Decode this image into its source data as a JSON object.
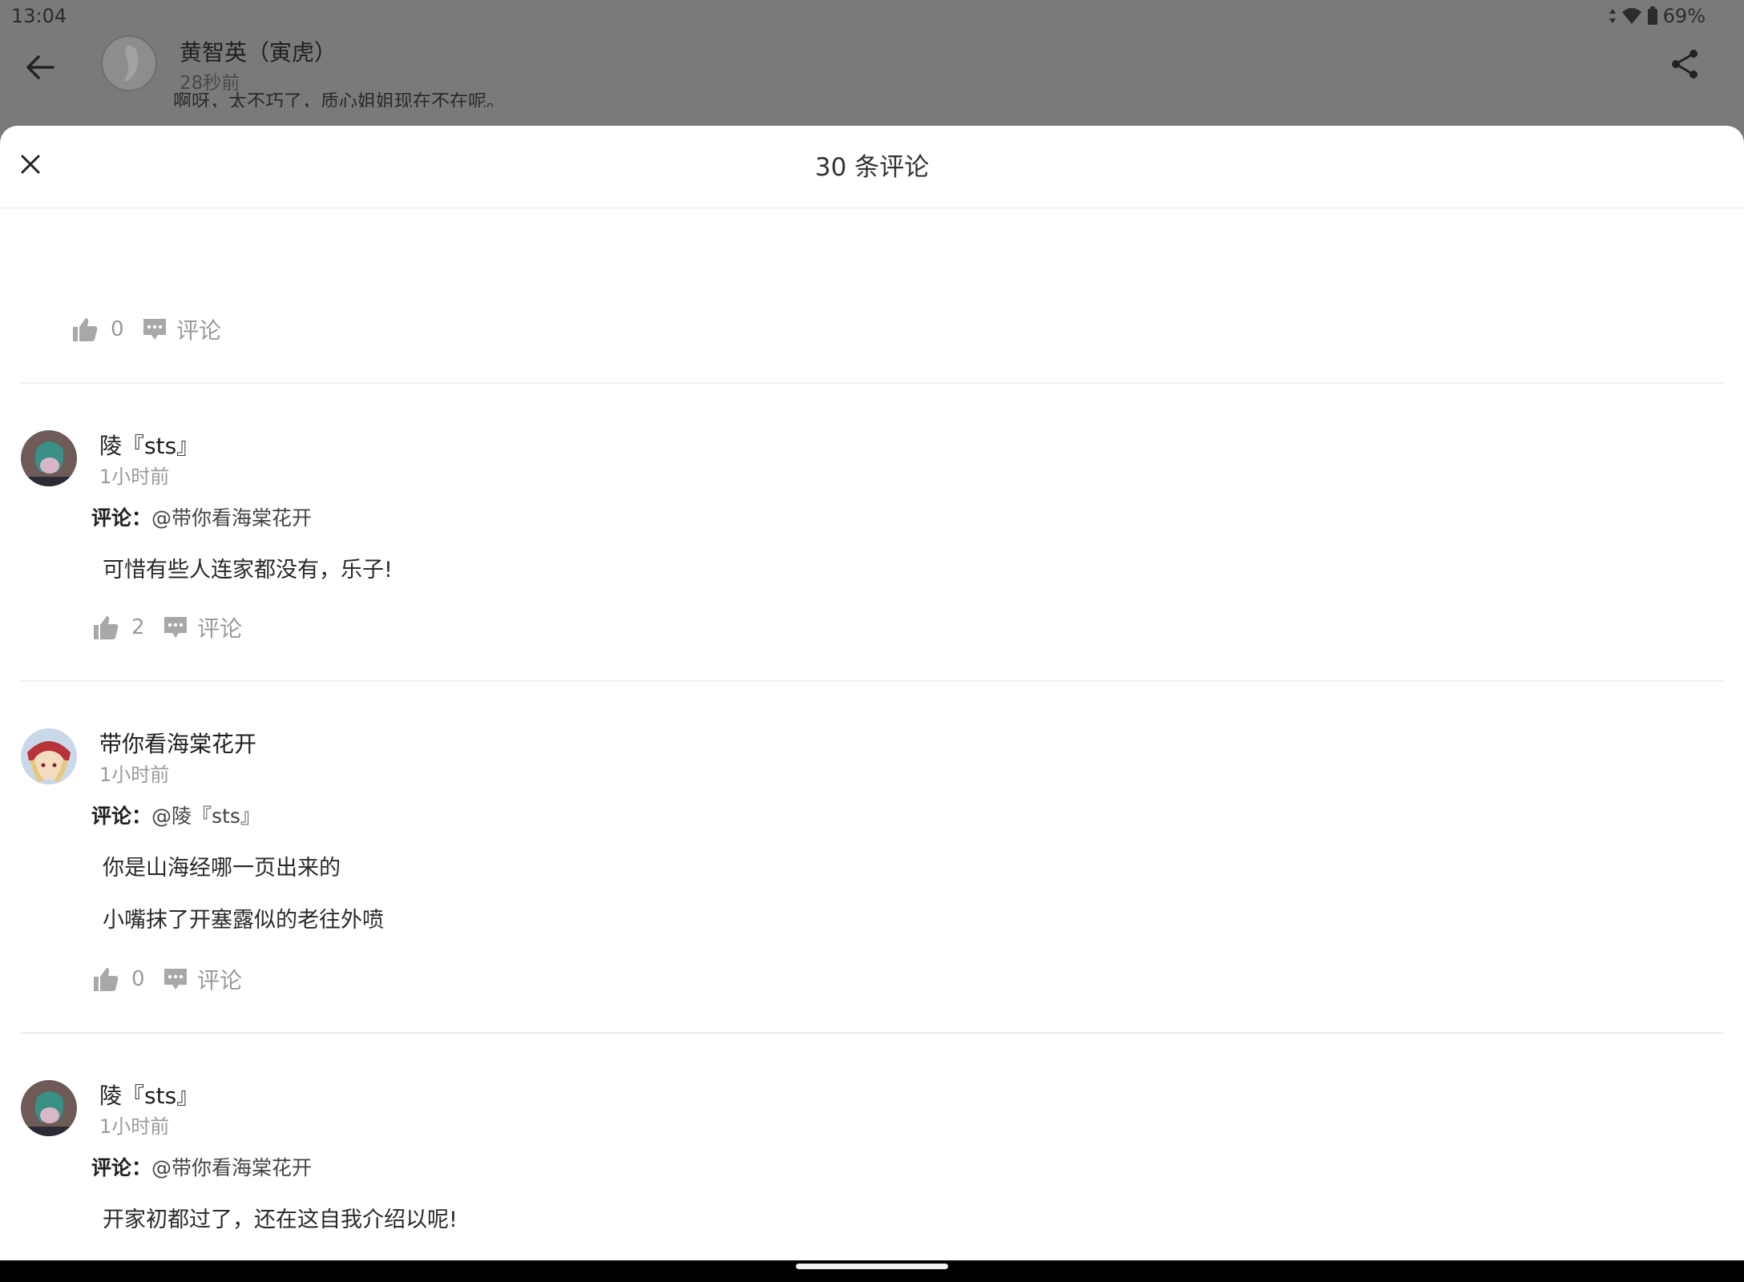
{
  "status_bar": {
    "time": "13:04",
    "battery": "69%",
    "icons": [
      "data-arrows-icon",
      "wifi-icon",
      "battery-icon"
    ]
  },
  "post": {
    "author_name": "黄智英（寅虎）",
    "posted_time": "28秒前",
    "snippet": "啊呀，太不巧了，质心姐姐现在不在呢。"
  },
  "sheet": {
    "title": "30 条评论"
  },
  "labels": {
    "reply_prefix": "评论：",
    "comment_action": "评论"
  },
  "comments": [
    {
      "likes": "0"
    },
    {
      "author": "陵『sts』",
      "time": "1小时前",
      "reply_to": "@带你看海棠花开",
      "lines": [
        "可惜有些人连家都没有，乐子!"
      ],
      "likes": "2"
    },
    {
      "author": "带你看海棠花开",
      "time": "1小时前",
      "reply_to": "@陵『sts』",
      "lines": [
        "你是山海经哪一页出来的",
        "小嘴抹了开塞露似的老往外喷"
      ],
      "likes": "0"
    },
    {
      "author": "陵『sts』",
      "time": "1小时前",
      "reply_to": "@带你看海棠花开",
      "lines": [
        "开家初都过了，还在这自我介绍以呢!"
      ]
    }
  ],
  "colors": {
    "dim_overlay": "#7a7a7a",
    "sheet_bg": "#ffffff",
    "muted_text": "#9a9a9a",
    "icon_gray": "#a8a8a8"
  }
}
